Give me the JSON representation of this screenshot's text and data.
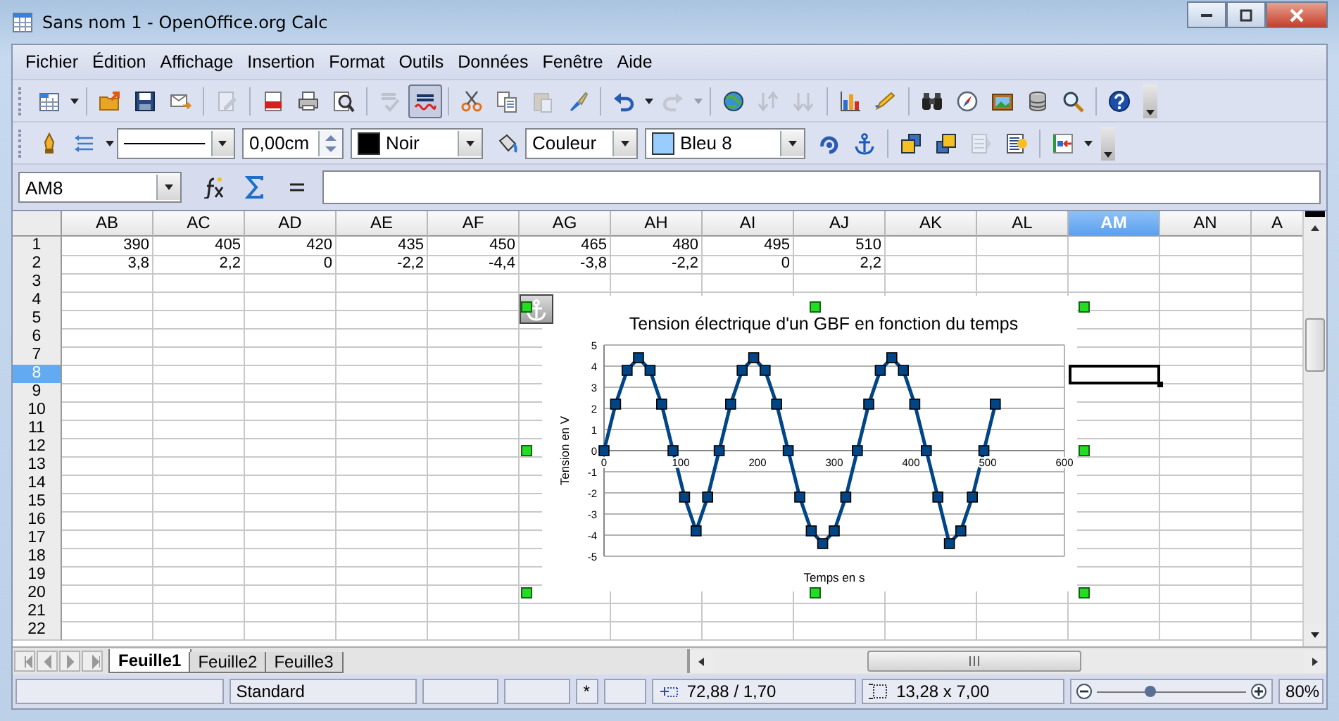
{
  "window": {
    "title": "Sans nom 1 - OpenOffice.org Calc"
  },
  "menu": [
    {
      "label": "Fichier"
    },
    {
      "label": "Édition"
    },
    {
      "label": "Affichage"
    },
    {
      "label": "Insertion"
    },
    {
      "label": "Format"
    },
    {
      "label": "Outils"
    },
    {
      "label": "Données"
    },
    {
      "label": "Fenêtre"
    },
    {
      "label": "Aide"
    }
  ],
  "standard_toolbar": [
    {
      "disabled": false,
      "pressed": false
    },
    {
      "disabled": false,
      "pressed": false
    },
    {
      "disabled": false,
      "pressed": false
    },
    {
      "disabled": false,
      "pressed": false
    },
    {
      "disabled": true,
      "pressed": false
    },
    {
      "disabled": false,
      "pressed": false
    },
    {
      "disabled": false,
      "pressed": false
    },
    {
      "disabled": false,
      "pressed": false
    },
    {
      "disabled": true,
      "pressed": false
    },
    {
      "disabled": false,
      "pressed": true
    },
    {
      "disabled": false,
      "pressed": false
    },
    {
      "disabled": false,
      "pressed": false
    },
    {
      "disabled": true,
      "pressed": false
    },
    {
      "disabled": false,
      "pressed": false
    },
    {
      "disabled": false,
      "pressed": false
    },
    {
      "disabled": true,
      "pressed": false
    },
    {
      "disabled": false,
      "pressed": false
    },
    {
      "disabled": true,
      "pressed": false
    },
    {
      "disabled": true,
      "pressed": false
    },
    {
      "disabled": false,
      "pressed": false
    },
    {
      "disabled": false,
      "pressed": false
    },
    {
      "disabled": false,
      "pressed": false
    },
    {
      "disabled": false,
      "pressed": false
    },
    {
      "disabled": false,
      "pressed": false
    },
    {
      "disabled": false,
      "pressed": false
    },
    {
      "disabled": false,
      "pressed": false
    },
    {
      "disabled": false,
      "pressed": false
    }
  ],
  "drawing_toolbar": {
    "line_width": "0,00cm",
    "line_color": "Noir",
    "area_style": "Couleur",
    "area_color": "Bleu 8",
    "buttons": [
      {
        "disabled": false
      },
      {
        "disabled": false
      },
      {
        "disabled": false
      },
      {
        "disabled": false
      },
      {
        "disabled": false
      },
      {
        "disabled": false
      },
      {
        "disabled": false
      },
      {
        "disabled": true
      },
      {
        "disabled": false
      },
      {
        "disabled": false
      }
    ]
  },
  "formula_bar": {
    "name_box": "AM8"
  },
  "sheet": {
    "columns": [
      {
        "label": "AB",
        "selected": false
      },
      {
        "label": "AC",
        "selected": false
      },
      {
        "label": "AD",
        "selected": false
      },
      {
        "label": "AE",
        "selected": false
      },
      {
        "label": "AF",
        "selected": false
      },
      {
        "label": "AG",
        "selected": false
      },
      {
        "label": "AH",
        "selected": false
      },
      {
        "label": "AI",
        "selected": false
      },
      {
        "label": "AJ",
        "selected": false
      },
      {
        "label": "AK",
        "selected": false
      },
      {
        "label": "AL",
        "selected": false
      },
      {
        "label": "AM",
        "selected": true
      },
      {
        "label": "AN",
        "selected": false
      },
      {
        "label": "A",
        "selected": false
      }
    ],
    "rows": [
      {
        "label": "1",
        "selected": false,
        "cells": [
          "390",
          "405",
          "420",
          "435",
          "450",
          "465",
          "480",
          "495",
          "510"
        ]
      },
      {
        "label": "2",
        "selected": false,
        "cells": [
          "3,8",
          "2,2",
          "0",
          "-2,2",
          "-4,4",
          "-3,8",
          "-2,2",
          "0",
          "2,2"
        ]
      },
      {
        "label": "3",
        "selected": false
      },
      {
        "label": "4",
        "selected": false
      },
      {
        "label": "5",
        "selected": false
      },
      {
        "label": "6",
        "selected": false
      },
      {
        "label": "7",
        "selected": false
      },
      {
        "label": "8",
        "selected": true
      },
      {
        "label": "9",
        "selected": false
      },
      {
        "label": "10",
        "selected": false
      },
      {
        "label": "11",
        "selected": false
      },
      {
        "label": "12",
        "selected": false
      },
      {
        "label": "13",
        "selected": false
      },
      {
        "label": "14",
        "selected": false
      },
      {
        "label": "15",
        "selected": false
      },
      {
        "label": "16",
        "selected": false
      },
      {
        "label": "17",
        "selected": false
      },
      {
        "label": "18",
        "selected": false
      },
      {
        "label": "19",
        "selected": false
      },
      {
        "label": "20",
        "selected": false
      },
      {
        "label": "21",
        "selected": false
      },
      {
        "label": "22",
        "selected": false
      }
    ]
  },
  "chart": {
    "chart_data": {
      "type": "line",
      "title": "Tension électrique d'un GBF en fonction du temps",
      "xlabel": "Temps en s",
      "ylabel": "Tension en V",
      "x": [
        0,
        15,
        30,
        45,
        60,
        75,
        90,
        105,
        120,
        135,
        150,
        165,
        180,
        195,
        210,
        225,
        240,
        255,
        270,
        285,
        300,
        315,
        330,
        345,
        360,
        375,
        390,
        405,
        420,
        435,
        450,
        465,
        480,
        495,
        510
      ],
      "grid": true,
      "series": [
        {
          "color": "#004586",
          "marker": "square",
          "values": [
            0,
            2.2,
            3.8,
            4.4,
            3.8,
            2.2,
            0,
            -2.2,
            -3.8,
            -2.2,
            0,
            2.2,
            3.8,
            4.4,
            3.8,
            2.2,
            0,
            -2.2,
            -3.8,
            -4.4,
            -3.8,
            -2.2,
            0,
            2.2,
            3.8,
            4.4,
            3.8,
            2.2,
            0,
            -2.2,
            -4.4,
            -3.8,
            -2.2,
            0,
            2.2
          ]
        }
      ],
      "xlim": [
        0,
        600
      ],
      "ylim": [
        -5,
        5
      ],
      "xticks": [
        0,
        100,
        200,
        300,
        400,
        500,
        600
      ],
      "yticks": [
        -5,
        -4,
        -3,
        -2,
        -1,
        0,
        1,
        2,
        3,
        4,
        5
      ]
    }
  },
  "sheet_tabs": [
    {
      "label": "Feuille1",
      "selected": true
    },
    {
      "label": "Feuille2",
      "selected": false
    },
    {
      "label": "Feuille3",
      "selected": false
    }
  ],
  "status_bar": {
    "page_style": "Standard",
    "modified": "*",
    "position": "72,88 / 1,70",
    "size": "13,28 x 7,00",
    "zoom_slider": {
      "level": 0.36
    },
    "zoom": "80%"
  }
}
